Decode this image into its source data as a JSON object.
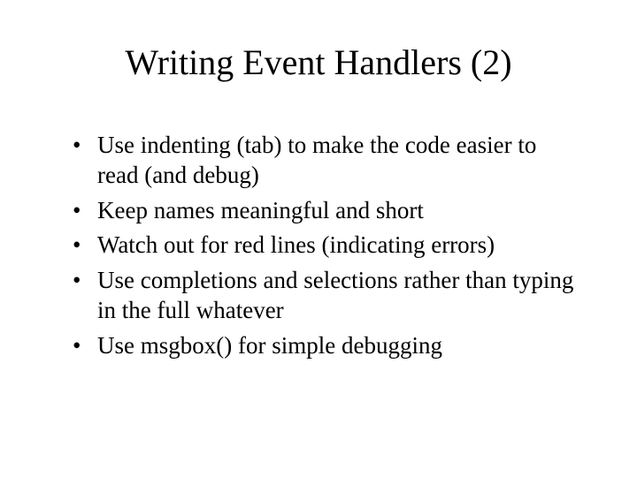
{
  "slide": {
    "title": "Writing Event Handlers (2)",
    "bullets": [
      "Use indenting (tab) to make the code easier to read (and debug)",
      "Keep names meaningful and short",
      "Watch out for red lines (indicating errors)",
      "Use completions and selections rather than typing in the full whatever",
      "Use msgbox() for simple debugging"
    ]
  }
}
